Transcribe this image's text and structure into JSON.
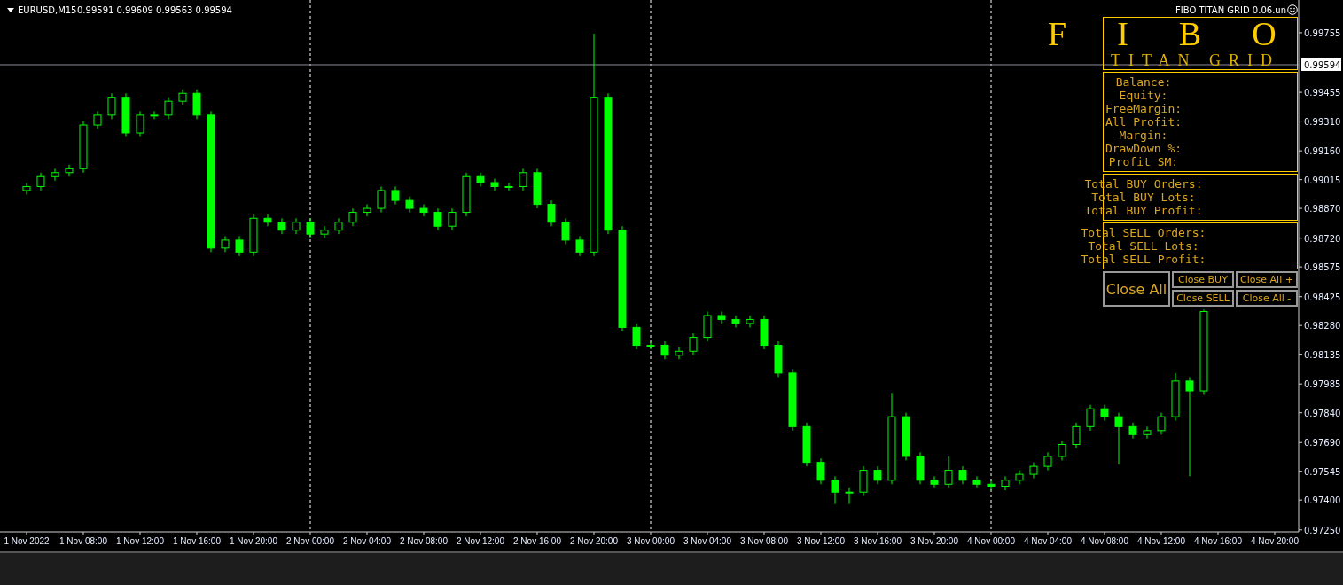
{
  "header": {
    "symbol": "EURUSD,M15",
    "ohlc": "0.99591 0.99609 0.99563 0.99594"
  },
  "chart_data": {
    "type": "candlestick",
    "ylim": [
      0.9724,
      0.9992
    ],
    "categories": [
      "1 Nov 2022",
      null,
      null,
      null,
      "1 Nov 08:00",
      null,
      null,
      null,
      "1 Nov 12:00",
      null,
      null,
      null,
      "1 Nov 16:00",
      null,
      null,
      null,
      "1 Nov 20:00",
      null,
      null,
      null,
      "2 Nov 00:00",
      null,
      null,
      null,
      "2 Nov 04:00",
      null,
      null,
      null,
      "2 Nov 08:00",
      null,
      null,
      null,
      "2 Nov 12:00",
      null,
      null,
      null,
      "2 Nov 16:00",
      null,
      null,
      null,
      "2 Nov 20:00",
      null,
      null,
      null,
      "3 Nov 00:00",
      null,
      null,
      null,
      "3 Nov 04:00",
      null,
      null,
      null,
      "3 Nov 08:00",
      null,
      null,
      null,
      "3 Nov 12:00",
      null,
      null,
      null,
      "3 Nov 16:00",
      null,
      null,
      null,
      "3 Nov 20:00",
      null,
      null,
      null,
      "4 Nov 00:00",
      null,
      null,
      null,
      "4 Nov 04:00",
      null,
      null,
      null,
      "4 Nov 08:00",
      null,
      null,
      null,
      "4 Nov 12:00",
      null,
      null,
      null,
      "4 Nov 16:00",
      null,
      null,
      null,
      "4 Nov 20:00",
      null,
      null,
      null
    ],
    "ohlc": [
      [
        0.9896,
        0.99,
        0.9894,
        0.9898
      ],
      [
        0.9898,
        0.9905,
        0.9896,
        0.9903
      ],
      [
        0.9903,
        0.9907,
        0.9901,
        0.9905
      ],
      [
        0.9905,
        0.9909,
        0.9903,
        0.9907
      ],
      [
        0.9907,
        0.9931,
        0.9905,
        0.9929
      ],
      [
        0.9929,
        0.9936,
        0.9927,
        0.9934
      ],
      [
        0.9934,
        0.9945,
        0.9932,
        0.9943
      ],
      [
        0.9943,
        0.9945,
        0.9923,
        0.9925
      ],
      [
        0.9925,
        0.9936,
        0.9923,
        0.9934
      ],
      [
        0.9934,
        0.9936,
        0.9932,
        0.9934
      ],
      [
        0.9934,
        0.9943,
        0.9932,
        0.9941
      ],
      [
        0.9941,
        0.9947,
        0.9939,
        0.9945
      ],
      [
        0.9945,
        0.9947,
        0.9932,
        0.9934
      ],
      [
        0.9934,
        0.9936,
        0.9865,
        0.9867
      ],
      [
        0.9867,
        0.9873,
        0.9865,
        0.9871
      ],
      [
        0.9871,
        0.9873,
        0.9863,
        0.9865
      ],
      [
        0.9865,
        0.9884,
        0.9863,
        0.9882
      ],
      [
        0.9882,
        0.9884,
        0.9878,
        0.988
      ],
      [
        0.988,
        0.9882,
        0.9874,
        0.9876
      ],
      [
        0.9876,
        0.9882,
        0.9874,
        0.988
      ],
      [
        0.988,
        0.9882,
        0.9872,
        0.9874
      ],
      [
        0.9874,
        0.9878,
        0.9872,
        0.9876
      ],
      [
        0.9876,
        0.9882,
        0.9874,
        0.988
      ],
      [
        0.988,
        0.9887,
        0.9878,
        0.9885
      ],
      [
        0.9885,
        0.9889,
        0.9883,
        0.9887
      ],
      [
        0.9887,
        0.9898,
        0.9885,
        0.9896
      ],
      [
        0.9896,
        0.9898,
        0.9889,
        0.9891
      ],
      [
        0.9891,
        0.9893,
        0.9885,
        0.9887
      ],
      [
        0.9887,
        0.9889,
        0.9883,
        0.9885
      ],
      [
        0.9885,
        0.9887,
        0.9876,
        0.9878
      ],
      [
        0.9878,
        0.9887,
        0.9876,
        0.9885
      ],
      [
        0.9885,
        0.9905,
        0.9883,
        0.9903
      ],
      [
        0.9903,
        0.9905,
        0.9898,
        0.99
      ],
      [
        0.99,
        0.9902,
        0.9896,
        0.9898
      ],
      [
        0.9898,
        0.99,
        0.9896,
        0.9898
      ],
      [
        0.9898,
        0.9907,
        0.9896,
        0.9905
      ],
      [
        0.9905,
        0.9907,
        0.9887,
        0.9889
      ],
      [
        0.9889,
        0.9891,
        0.9878,
        0.988
      ],
      [
        0.988,
        0.9882,
        0.9869,
        0.9871
      ],
      [
        0.9871,
        0.9873,
        0.9863,
        0.9865
      ],
      [
        0.9865,
        0.9975,
        0.9863,
        0.9943
      ],
      [
        0.9943,
        0.9945,
        0.9874,
        0.9876
      ],
      [
        0.9876,
        0.9878,
        0.9825,
        0.9827
      ],
      [
        0.9827,
        0.9829,
        0.9816,
        0.9818
      ],
      [
        0.9818,
        0.982,
        0.9816,
        0.9818
      ],
      [
        0.9818,
        0.982,
        0.9811,
        0.9813
      ],
      [
        0.9813,
        0.9817,
        0.9811,
        0.9815
      ],
      [
        0.9815,
        0.9824,
        0.9813,
        0.9822
      ],
      [
        0.9822,
        0.9835,
        0.982,
        0.9833
      ],
      [
        0.9833,
        0.9835,
        0.9829,
        0.9831
      ],
      [
        0.9831,
        0.9833,
        0.9827,
        0.9829
      ],
      [
        0.9829,
        0.9833,
        0.9827,
        0.9831
      ],
      [
        0.9831,
        0.9833,
        0.9816,
        0.9818
      ],
      [
        0.9818,
        0.982,
        0.9802,
        0.9804
      ],
      [
        0.9804,
        0.9806,
        0.9775,
        0.9777
      ],
      [
        0.9777,
        0.9779,
        0.9757,
        0.9759
      ],
      [
        0.9759,
        0.9761,
        0.9748,
        0.975
      ],
      [
        0.975,
        0.9752,
        0.9738,
        0.9744
      ],
      [
        0.9744,
        0.9746,
        0.9738,
        0.9744
      ],
      [
        0.9744,
        0.9757,
        0.9742,
        0.9755
      ],
      [
        0.9755,
        0.9757,
        0.9748,
        0.975
      ],
      [
        0.975,
        0.9794,
        0.9748,
        0.9782
      ],
      [
        0.9782,
        0.9784,
        0.976,
        0.9762
      ],
      [
        0.9762,
        0.9764,
        0.9748,
        0.975
      ],
      [
        0.975,
        0.9752,
        0.9746,
        0.9748
      ],
      [
        0.9748,
        0.9762,
        0.9746,
        0.9755
      ],
      [
        0.9755,
        0.9757,
        0.9748,
        0.975
      ],
      [
        0.975,
        0.9752,
        0.9746,
        0.9748
      ],
      [
        0.9748,
        0.975,
        0.9745,
        0.9747
      ],
      [
        0.9747,
        0.9752,
        0.9745,
        0.975
      ],
      [
        0.975,
        0.9755,
        0.9748,
        0.9753
      ],
      [
        0.9753,
        0.9759,
        0.9751,
        0.9757
      ],
      [
        0.9757,
        0.9764,
        0.9755,
        0.9762
      ],
      [
        0.9762,
        0.977,
        0.976,
        0.9768
      ],
      [
        0.9768,
        0.9779,
        0.9766,
        0.9777
      ],
      [
        0.9777,
        0.9788,
        0.9775,
        0.9786
      ],
      [
        0.9786,
        0.9788,
        0.978,
        0.9782
      ],
      [
        0.9782,
        0.9784,
        0.9758,
        0.9777
      ],
      [
        0.9777,
        0.9779,
        0.9771,
        0.9773
      ],
      [
        0.9773,
        0.9777,
        0.9771,
        0.9775
      ],
      [
        0.9775,
        0.9784,
        0.9773,
        0.9782
      ],
      [
        0.9782,
        0.9804,
        0.978,
        0.98
      ],
      [
        0.98,
        0.9802,
        0.9752,
        0.9795
      ],
      [
        0.9795,
        0.9836,
        0.9793,
        0.9835
      ],
      null,
      null,
      null,
      null,
      null,
      null,
      null,
      null
    ],
    "yticks": [
      {
        "value": 0.99755,
        "label": "0.99755"
      },
      {
        "value": 0.99455,
        "label": "0.99455"
      },
      {
        "value": 0.9931,
        "label": "0.99310"
      },
      {
        "value": 0.9916,
        "label": "0.99160"
      },
      {
        "value": 0.99015,
        "label": "0.99015"
      },
      {
        "value": 0.9887,
        "label": "0.98870"
      },
      {
        "value": 0.9872,
        "label": "0.98720"
      },
      {
        "value": 0.98575,
        "label": "0.98575"
      },
      {
        "value": 0.98425,
        "label": "0.98425"
      },
      {
        "value": 0.9828,
        "label": "0.98280"
      },
      {
        "value": 0.98135,
        "label": "0.98135"
      },
      {
        "value": 0.97985,
        "label": "0.97985"
      },
      {
        "value": 0.9784,
        "label": "0.97840"
      },
      {
        "value": 0.9769,
        "label": "0.97690"
      },
      {
        "value": 0.97545,
        "label": "0.97545"
      },
      {
        "value": 0.974,
        "label": "0.97400"
      },
      {
        "value": 0.9725,
        "label": "0.97250"
      }
    ],
    "ref_lines": [
      {
        "axis": "x",
        "value": "2 Nov 00:00"
      },
      {
        "axis": "x",
        "value": "3 Nov 00:00"
      },
      {
        "axis": "x",
        "value": "4 Nov 00:00"
      },
      {
        "axis": "y",
        "value": 0.99594,
        "label": "0.99594"
      }
    ]
  },
  "expert": {
    "title": "FIBO TITAN GRID 0.06.un",
    "logo": "F I B O",
    "subtitle": "TITAN GRID",
    "groups": [
      [
        "Balance:",
        "Equity:",
        "FreeMargin:",
        "All Profit:",
        "Margin:",
        "DrawDown %:",
        "Profit SM:"
      ],
      [
        "Total BUY Orders:",
        "Total BUY Lots:",
        "Total BUY Profit:"
      ],
      [
        "Total SELL Orders:",
        "Total SELL Lots:",
        "Total SELL Profit:"
      ]
    ],
    "close_all": "Close All",
    "buttons": [
      "Close BUY",
      "Close SELL",
      "Close All +",
      "Close All -"
    ]
  }
}
